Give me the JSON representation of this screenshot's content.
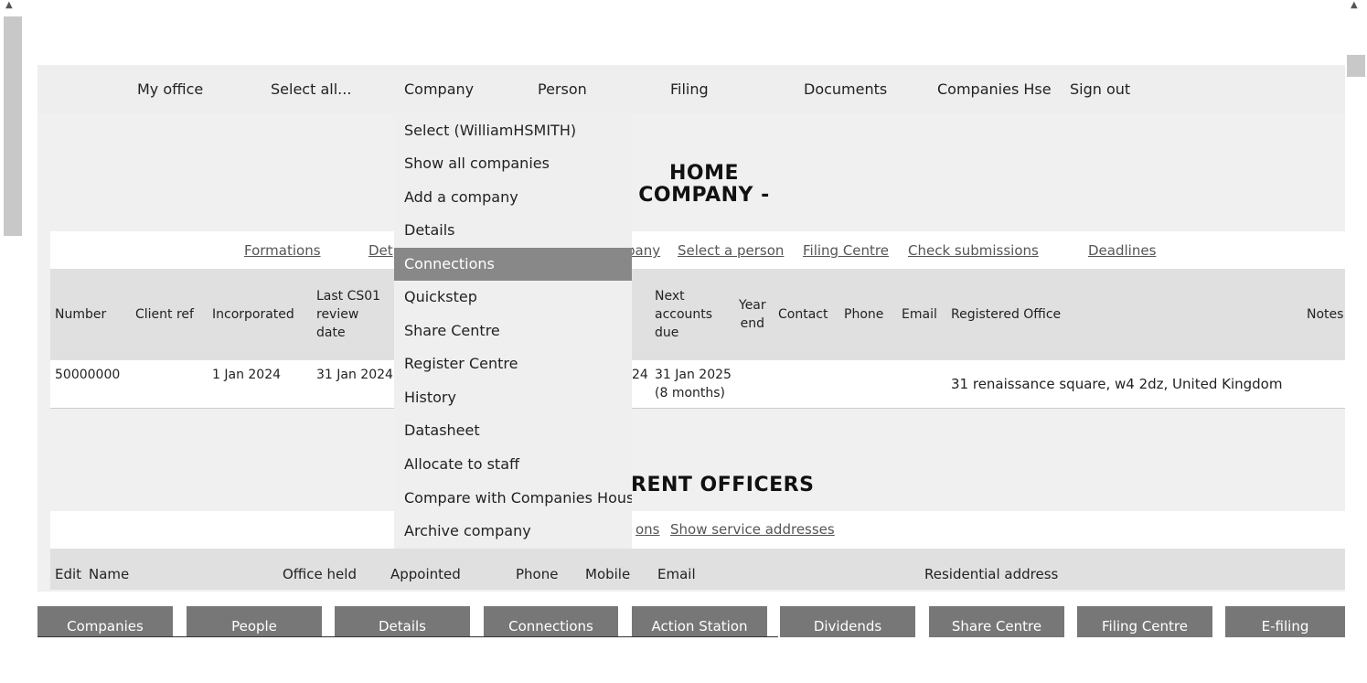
{
  "topnav": {
    "items": [
      "My office",
      "Select all...",
      "Company",
      "Person",
      "Filing",
      "Documents",
      "Companies Hse",
      "Sign out"
    ]
  },
  "company_menu": {
    "items": [
      "Select (WilliamHSMITH)",
      "Show all companies",
      "Add a company",
      "Details",
      "Connections",
      "Quickstep",
      "Share Centre",
      "Register Centre",
      "History",
      "Datasheet",
      "Allocate to staff",
      "Compare with Companies House",
      "Archive company"
    ],
    "active": "Connections"
  },
  "heading1": {
    "line1": "HOME",
    "line2": "COMPANY -"
  },
  "linkbar": {
    "formations": "Formations",
    "details_partial": "Det",
    "company_partial": "pany",
    "select_person": "Select a person",
    "filing_centre": "Filing Centre",
    "check_submissions": "Check submissions",
    "deadlines": "Deadlines"
  },
  "company_table": {
    "headers": {
      "number": "Number",
      "client_ref": "Client ref",
      "incorporated": "Incorporated",
      "last_cs01": [
        "Last CS01",
        "review",
        "date"
      ],
      "next_accounts": [
        "Next",
        "accounts",
        "due"
      ],
      "year_end": [
        "Year",
        "end"
      ],
      "contact": "Contact",
      "phone": "Phone",
      "email": "Email",
      "registered_office": "Registered Office",
      "notes": "Notes"
    },
    "row": {
      "number": "50000000",
      "incorporated": "1 Jan 2024",
      "last_cs01": "31 Jan 2024",
      "hidden_partial": "24",
      "next_accounts": [
        "31 Jan 2025",
        "(8 months)"
      ],
      "registered_office": "31 renaissance square, w4 2dz, United Kingdom"
    }
  },
  "heading2": {
    "text": "RENT OFFICERS"
  },
  "linkbar2": {
    "partial": "ons",
    "show_service_addresses": "Show service addresses"
  },
  "officers_table": {
    "headers": {
      "edit": "Edit",
      "name": "Name",
      "office_held": "Office held",
      "appointed": "Appointed",
      "phone": "Phone",
      "mobile": "Mobile",
      "email": "Email",
      "residential_address": "Residential address"
    }
  },
  "bottom_tabs": [
    "Companies",
    "People",
    "Details",
    "Connections",
    "Action Station",
    "Dividends",
    "Share Centre",
    "Filing Centre",
    "E-filing"
  ]
}
